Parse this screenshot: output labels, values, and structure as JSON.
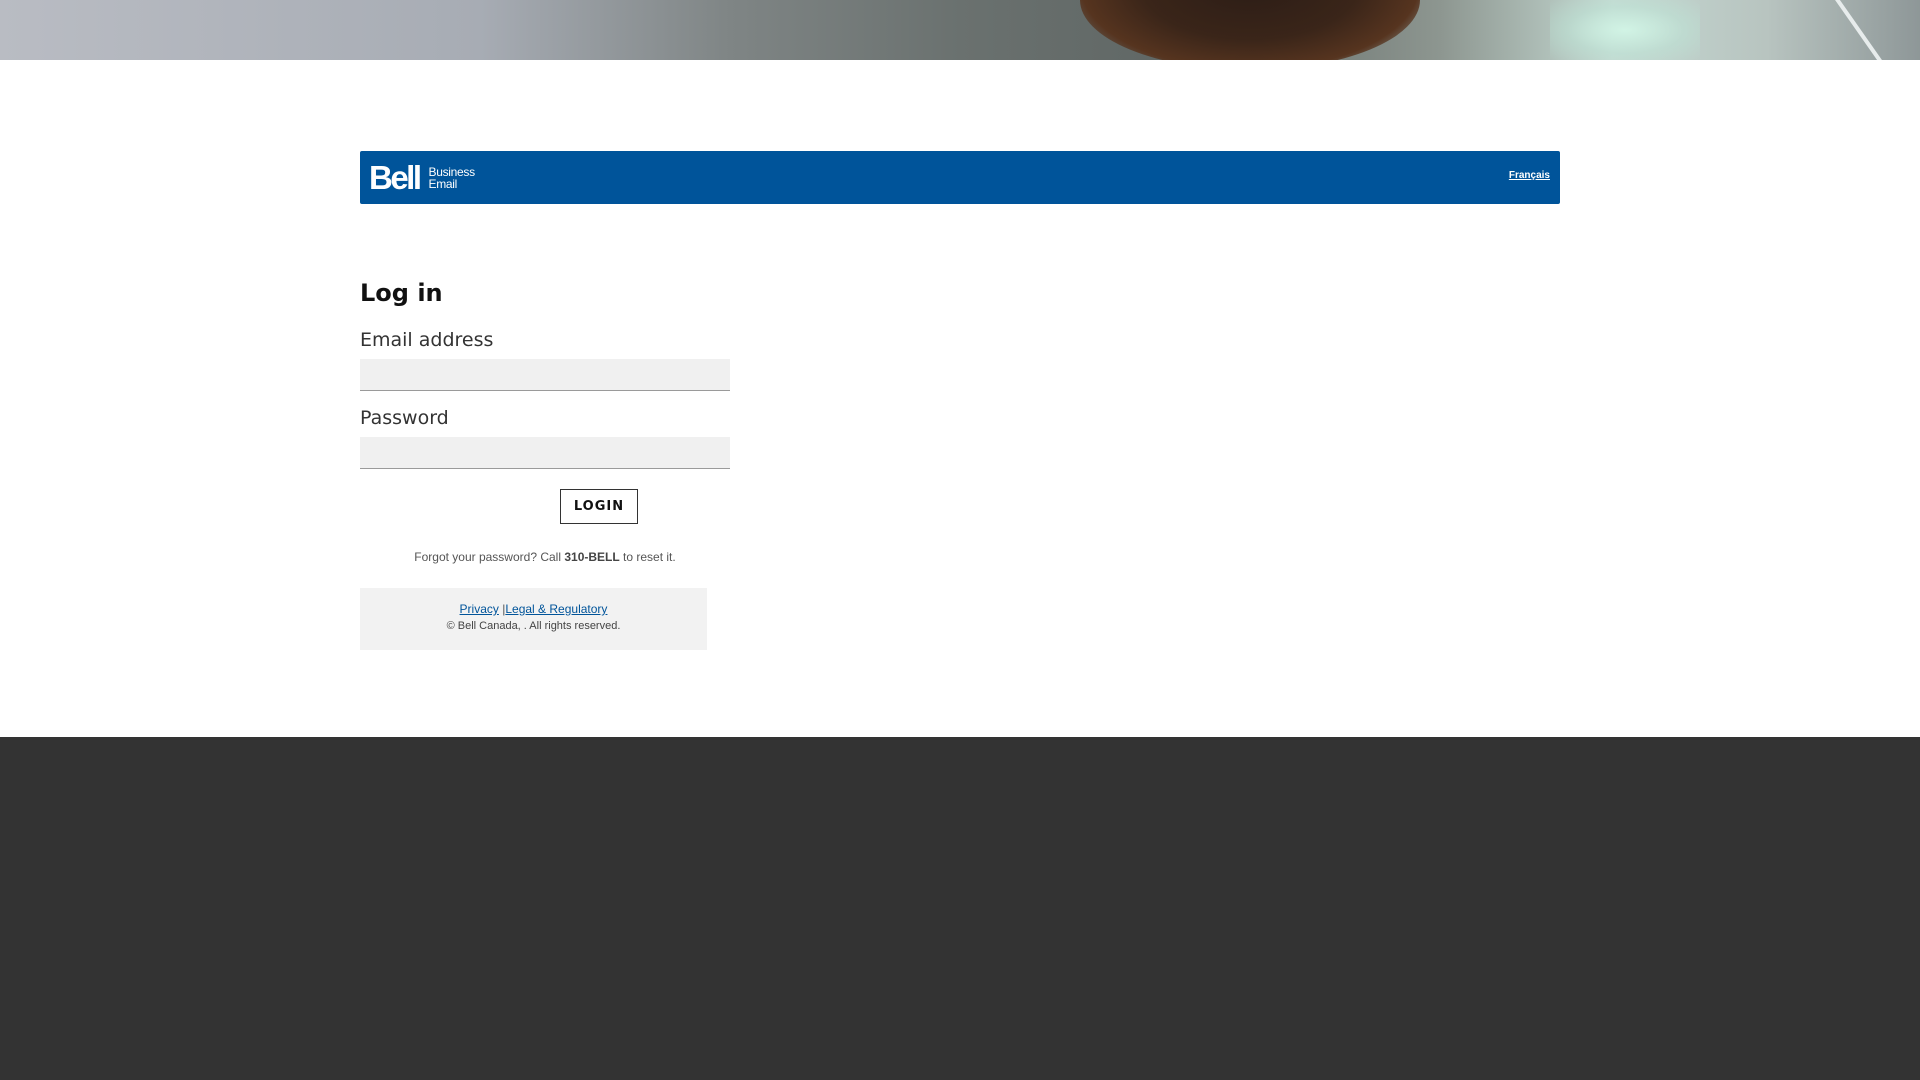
{
  "header": {
    "logo_word": "Bell",
    "logo_sub_line1": "Business",
    "logo_sub_line2": "Email",
    "language_link": "Français"
  },
  "login": {
    "title": "Log in",
    "email_label": "Email address",
    "email_value": "",
    "password_label": "Password",
    "password_value": "",
    "submit_label": "LOGIN"
  },
  "forgot": {
    "prefix": "Forgot your password? Call ",
    "phone": "310-BELL",
    "suffix": " to reset it."
  },
  "footer": {
    "privacy_link": "Privacy",
    "separator": "|",
    "legal_link": "Legal & Regulatory",
    "copyright": "© Bell Canada, . All rights reserved."
  },
  "colors": {
    "brand_blue": "#00549a",
    "bottom_band": "#333333",
    "input_bg": "#f0f0f0",
    "footer_bg": "#f2f2f2"
  },
  "icons": {
    "logo": "bell-logo"
  }
}
